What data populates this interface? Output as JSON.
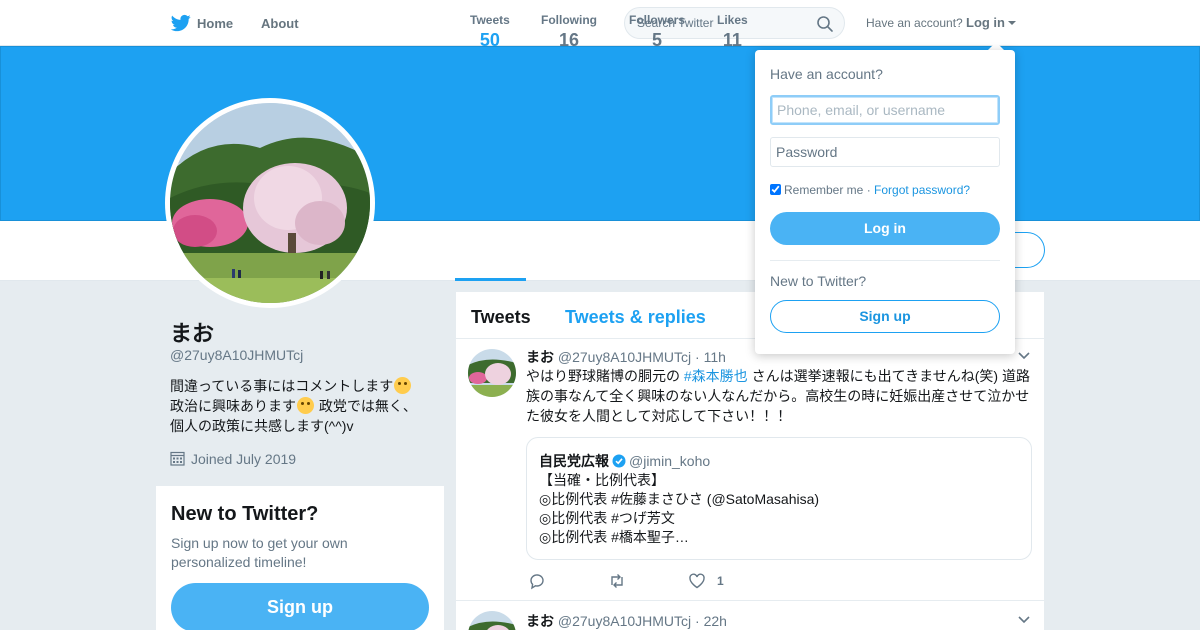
{
  "nav": {
    "home": "Home",
    "about": "About",
    "search_placeholder": "Search Twitter",
    "have_account": "Have an account?",
    "login": "Log in"
  },
  "profile": {
    "name": "まお",
    "handle": "@27uy8A10JHMUTcj",
    "bio_line1": "間違っている事にはコメントします",
    "bio_line2a": "政治に興味あります",
    "bio_line2b": " 政党では無く、",
    "bio_line3": "個人の政策に共感します(^^)v",
    "joined": "Joined July 2019"
  },
  "stats": [
    {
      "label": "Tweets",
      "value": "50"
    },
    {
      "label": "Following",
      "value": "16"
    },
    {
      "label": "Followers",
      "value": "5"
    },
    {
      "label": "Likes",
      "value": "11"
    }
  ],
  "signup_module": {
    "title": "New to Twitter?",
    "subtitle": "Sign up now to get your own personalized timeline!",
    "button": "Sign up"
  },
  "timeline": {
    "tabs": [
      "Tweets",
      "Tweets & replies"
    ],
    "tweets": [
      {
        "name": "まお",
        "handle": "@27uy8A10JHMUTcj",
        "time": "· 11h",
        "text_before": "やはり野球賭博の胴元の ",
        "hashtag": "#森本勝也",
        "text_after": " さんは選挙速報にも出てきませんね(笑) 道路族の事なんて全く興味のない人なんだから。高校生の時に妊娠出産させて泣かせた彼女を人間として対応して下さい！！！",
        "quote": {
          "name": "自民党広報",
          "handle": "@jimin_koho",
          "lines": [
            "【当確・比例代表】",
            "◎比例代表 #佐藤まさひさ (@SatoMasahisa)",
            "◎比例代表 #つげ芳文",
            "◎比例代表 #橋本聖子…"
          ]
        },
        "likes": "1"
      },
      {
        "name": "まお",
        "handle": "@27uy8A10JHMUTcj",
        "time": "· 22h"
      }
    ]
  },
  "login_dropdown": {
    "heading": "Have an account?",
    "username_placeholder": "Phone, email, or username",
    "password_placeholder": "Password",
    "remember": "Remember me",
    "separator": " · ",
    "forgot": "Forgot password?",
    "login_button": "Log in",
    "new_to_twitter": "New to Twitter?",
    "signup_button": "Sign up"
  },
  "colors": {
    "brand": "#1da1f2",
    "button": "#4ab3f4",
    "link": "#1b95e0"
  }
}
